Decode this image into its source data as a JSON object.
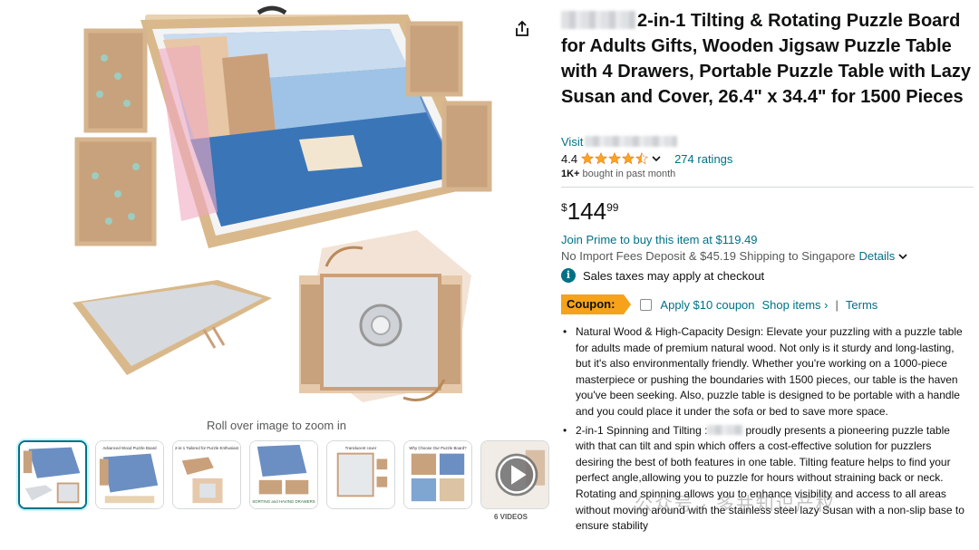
{
  "gallery": {
    "zoom_hint": "Roll over image to zoom in",
    "videos_caption": "6 VIDEOS",
    "thumbnails": [
      {
        "label": ""
      },
      {
        "label": "Advanced Wood Puzzle Board"
      },
      {
        "label": "2-in-1 Tailored for Puzzle Enthusiast"
      },
      {
        "label": "SORTING and HAVING DRAWERS"
      },
      {
        "label": "Translucent cover"
      },
      {
        "label": "Why Choose Our Puzzle Board?"
      }
    ]
  },
  "product": {
    "title": "2-in-1 Tilting & Rotating Puzzle Board for Adults Gifts, Wooden Jigsaw Puzzle Table with 4 Drawers, Portable Puzzle Table with Lazy Susan and Cover, 26.4\" x 34.4\" for 1500 Pieces",
    "store_prefix": "Visit",
    "rating_value": "4.4",
    "rating_stars": 4.4,
    "ratings_count": "274 ratings",
    "bought_bold": "1K+",
    "bought_rest": " bought in past month",
    "price": {
      "symbol": "$",
      "whole": "144",
      "fraction": "99"
    },
    "prime_text": "Join Prime to buy this item at $119.49",
    "import_text": "No Import Fees Deposit & $45.19 Shipping to Singapore",
    "details_link": "Details",
    "tax_text": "Sales taxes may apply at checkout",
    "coupon": {
      "badge": "Coupon:",
      "label": "Apply $10 coupon",
      "shop_link": "Shop items ›",
      "separator": "|",
      "terms": "Terms"
    },
    "bullets": [
      {
        "text": "Natural Wood & High-Capacity Design: Elevate your puzzling with a puzzle table for adults made of premium natural wood. Not only is it sturdy and long-lasting, but it's also environmentally friendly. Whether you're working on a 1000-piece masterpiece or pushing the boundaries with 1500 pieces, our table is the haven you've been seeking. Also, puzzle table is designed to be portable with a handle and you could place it under the sofa or bed to save more space."
      },
      {
        "pre": "2-in-1 Spinning and Tilting :",
        "post": "proudly presents a pioneering puzzle table with that can tilt and spin which offers a cost-effective solution for puzzlers desiring the best of both features in one table. Tilting feature helps to find your perfect angle,allowing you to puzzle for hours without straining back or neck. Rotating and spinning allows you to enhance visibility and access to all areas without moving around with the stainless steel lazy Susan with a non-slip base to ensure stability"
      }
    ]
  },
  "watermark": "公众号 · 多井知识产权",
  "colors": {
    "link": "#007185",
    "coupon": "#f7a21b",
    "star": "#ffa41c",
    "text": "#0f1111",
    "muted": "#565959"
  }
}
